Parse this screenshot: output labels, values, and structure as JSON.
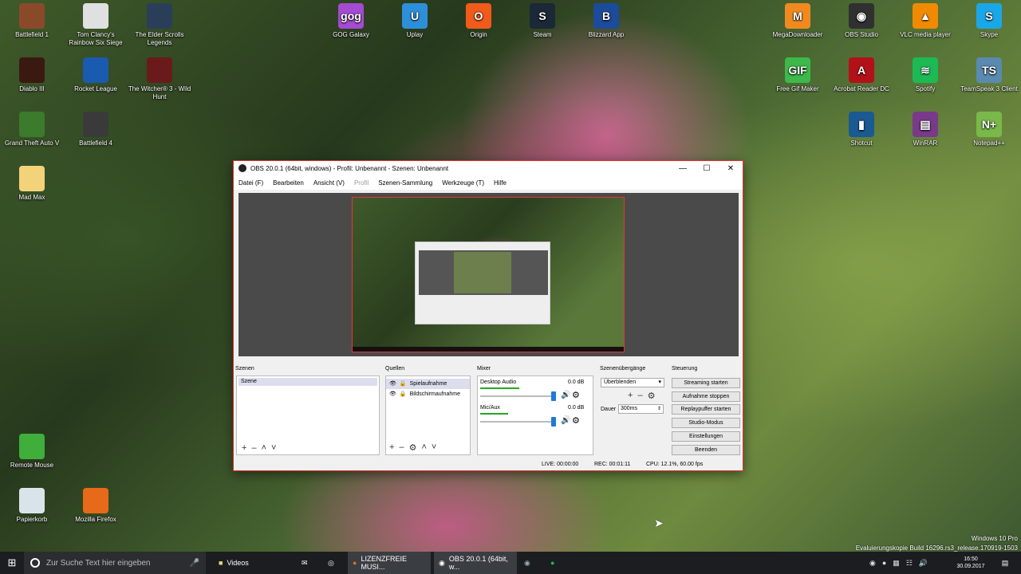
{
  "desktop": {
    "icons_left": [
      {
        "label": "Battlefield 1",
        "icon": "battlefield-icon",
        "color": "#8a4a2a"
      },
      {
        "label": "Tom Clancy's Rainbow Six Siege",
        "icon": "rainbow-six-icon",
        "color": "#e0e0e0"
      },
      {
        "label": "The Elder Scrolls Legends",
        "icon": "elder-scrolls-icon",
        "color": "#2a3e5a"
      },
      {
        "label": "Diablo III",
        "icon": "diablo-icon",
        "color": "#3a1a10"
      },
      {
        "label": "Rocket League",
        "icon": "rocket-league-icon",
        "color": "#1a5ab0"
      },
      {
        "label": "The Witcher® 3 - Wild Hunt",
        "icon": "witcher-icon",
        "color": "#6a1a1a"
      },
      {
        "label": "Grand Theft Auto V",
        "icon": "gta-icon",
        "color": "#3c7a2c"
      },
      {
        "label": "Battlefield 4",
        "icon": "battlefield4-icon",
        "color": "#3a3a3a"
      },
      {
        "label": "Mad Max",
        "icon": "folder-icon",
        "color": "#f2d37a"
      },
      {
        "label": "Remote Mouse",
        "icon": "remote-mouse-icon",
        "color": "#3fae3a"
      },
      {
        "label": "Papierkorb",
        "icon": "recycle-bin-icon",
        "color": "#d9e4ea"
      },
      {
        "label": "Mozilla Firefox",
        "icon": "firefox-icon",
        "color": "#e66a1a"
      }
    ],
    "icons_top": [
      {
        "label": "GOG Galaxy",
        "icon": "gog-icon",
        "color": "#a34bd1",
        "glyph": "gog"
      },
      {
        "label": "Uplay",
        "icon": "uplay-icon",
        "color": "#2e8fd9",
        "glyph": "U"
      },
      {
        "label": "Origin",
        "icon": "origin-icon",
        "color": "#f05a1a",
        "glyph": "O"
      },
      {
        "label": "Steam",
        "icon": "steam-icon",
        "color": "#1b2838",
        "glyph": "S"
      },
      {
        "label": "Blizzard App",
        "icon": "blizzard-icon",
        "color": "#1b4b9a",
        "glyph": "B"
      }
    ],
    "icons_right": [
      {
        "label": "MegaDownloader",
        "icon": "megadownloader-icon",
        "color": "#f08a20",
        "glyph": "M"
      },
      {
        "label": "OBS Studio",
        "icon": "obs-icon",
        "color": "#303030",
        "glyph": "◉"
      },
      {
        "label": "VLC media player",
        "icon": "vlc-icon",
        "color": "#f08a00",
        "glyph": "▲"
      },
      {
        "label": "Skype",
        "icon": "skype-icon",
        "color": "#1aa7e8",
        "glyph": "S"
      },
      {
        "label": "Free Gif Maker",
        "icon": "gif-maker-icon",
        "color": "#3cb94a",
        "glyph": "GIF"
      },
      {
        "label": "Acrobat Reader DC",
        "icon": "acrobat-icon",
        "color": "#b3111a",
        "glyph": "A"
      },
      {
        "label": "Spotify",
        "icon": "spotify-icon",
        "color": "#1db954",
        "glyph": "≋"
      },
      {
        "label": "TeamSpeak 3 Client",
        "icon": "teamspeak-icon",
        "color": "#5a8ab0",
        "glyph": "TS"
      },
      {
        "label": "Shotcut",
        "icon": "shotcut-icon",
        "color": "#1a5a90",
        "glyph": "▮"
      },
      {
        "label": "WinRAR",
        "icon": "winrar-icon",
        "color": "#7a3a8a",
        "glyph": "▤"
      },
      {
        "label": "Notepad++",
        "icon": "notepadpp-icon",
        "color": "#7ab84a",
        "glyph": "N+"
      }
    ]
  },
  "obs": {
    "title": "OBS 20.0.1 (64bit, windows) - Profil: Unbenannt - Szenen: Unbenannt",
    "menu": [
      "Datei (F)",
      "Bearbeiten",
      "Ansicht (V)",
      "Profil",
      "Szenen-Sammlung",
      "Werkzeuge (T)",
      "Hilfe"
    ],
    "docks": {
      "scenes": "Szenen",
      "sources": "Quellen",
      "mixer": "Mixer",
      "transitions": "Szenenübergänge",
      "controls": "Steuerung"
    },
    "scenes": [
      "Szene"
    ],
    "sources": [
      "Spielaufnahme",
      "Bildschirmaufnahme"
    ],
    "mixer": [
      {
        "name": "Desktop Audio",
        "db": "0.0 dB",
        "level": 0.35
      },
      {
        "name": "Mic/Aux",
        "db": "0.0 dB",
        "level": 0.25
      }
    ],
    "transition": {
      "selected": "Überblenden",
      "duration_label": "Dauer",
      "duration": "300ms"
    },
    "controls": [
      "Streaming starten",
      "Aufnahme stoppen",
      "Replaypuffer starten",
      "Studio-Modus",
      "Einstellungen",
      "Beenden"
    ],
    "status": {
      "live": "LIVE: 00:00:00",
      "rec": "REC: 00:01:11",
      "cpu": "CPU: 12.1%, 60.00 fps"
    }
  },
  "taskbar": {
    "search_placeholder": "Zur Suche Text hier eingeben",
    "items": [
      "Videos",
      "LIZENZFREIE MUSI...",
      "OBS 20.0.1 (64bit, w..."
    ],
    "time": "16:50",
    "date": "30.09.2017"
  },
  "watermark": {
    "line1": "Windows 10 Pro",
    "line2": "Evaluierungskopie Build 16296.rs3_release.170919-1503"
  }
}
